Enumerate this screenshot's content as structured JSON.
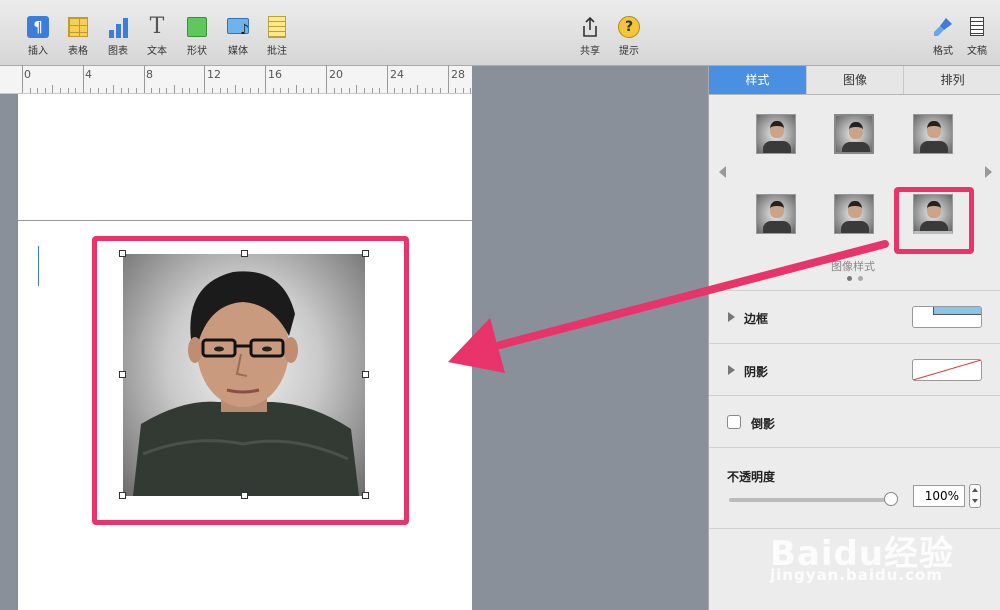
{
  "toolbar": {
    "left_items": [
      {
        "label": "插入",
        "icon": "paragraph-icon"
      },
      {
        "label": "表格",
        "icon": "table-icon"
      },
      {
        "label": "图表",
        "icon": "chart-icon"
      },
      {
        "label": "文本",
        "icon": "text-icon"
      },
      {
        "label": "形状",
        "icon": "shape-icon"
      },
      {
        "label": "媒体",
        "icon": "media-icon"
      },
      {
        "label": "批注",
        "icon": "comment-icon"
      }
    ],
    "center_items": [
      {
        "label": "共享",
        "icon": "share-icon"
      },
      {
        "label": "提示",
        "icon": "tips-icon"
      }
    ],
    "right_items": [
      {
        "label": "格式",
        "icon": "format-brush-icon"
      },
      {
        "label": "文稿",
        "icon": "document-icon"
      }
    ]
  },
  "ruler": {
    "marks": [
      "0",
      "4",
      "8",
      "12",
      "16",
      "20",
      "24",
      "28"
    ]
  },
  "sidebar": {
    "tabs": [
      "样式",
      "图像",
      "排列"
    ],
    "active_tab": "样式",
    "styles_caption": "图像样式",
    "border_label": "边框",
    "shadow_label": "阴影",
    "reflection_label": "倒影",
    "opacity_label": "不透明度",
    "opacity_value": "100%",
    "opacity_fraction": 1.0
  },
  "watermark": {
    "main": "Baidu经验",
    "sub": "jingyan.baidu.com"
  },
  "colors": {
    "highlight": "#e8336b",
    "accent": "#4a90e2"
  }
}
